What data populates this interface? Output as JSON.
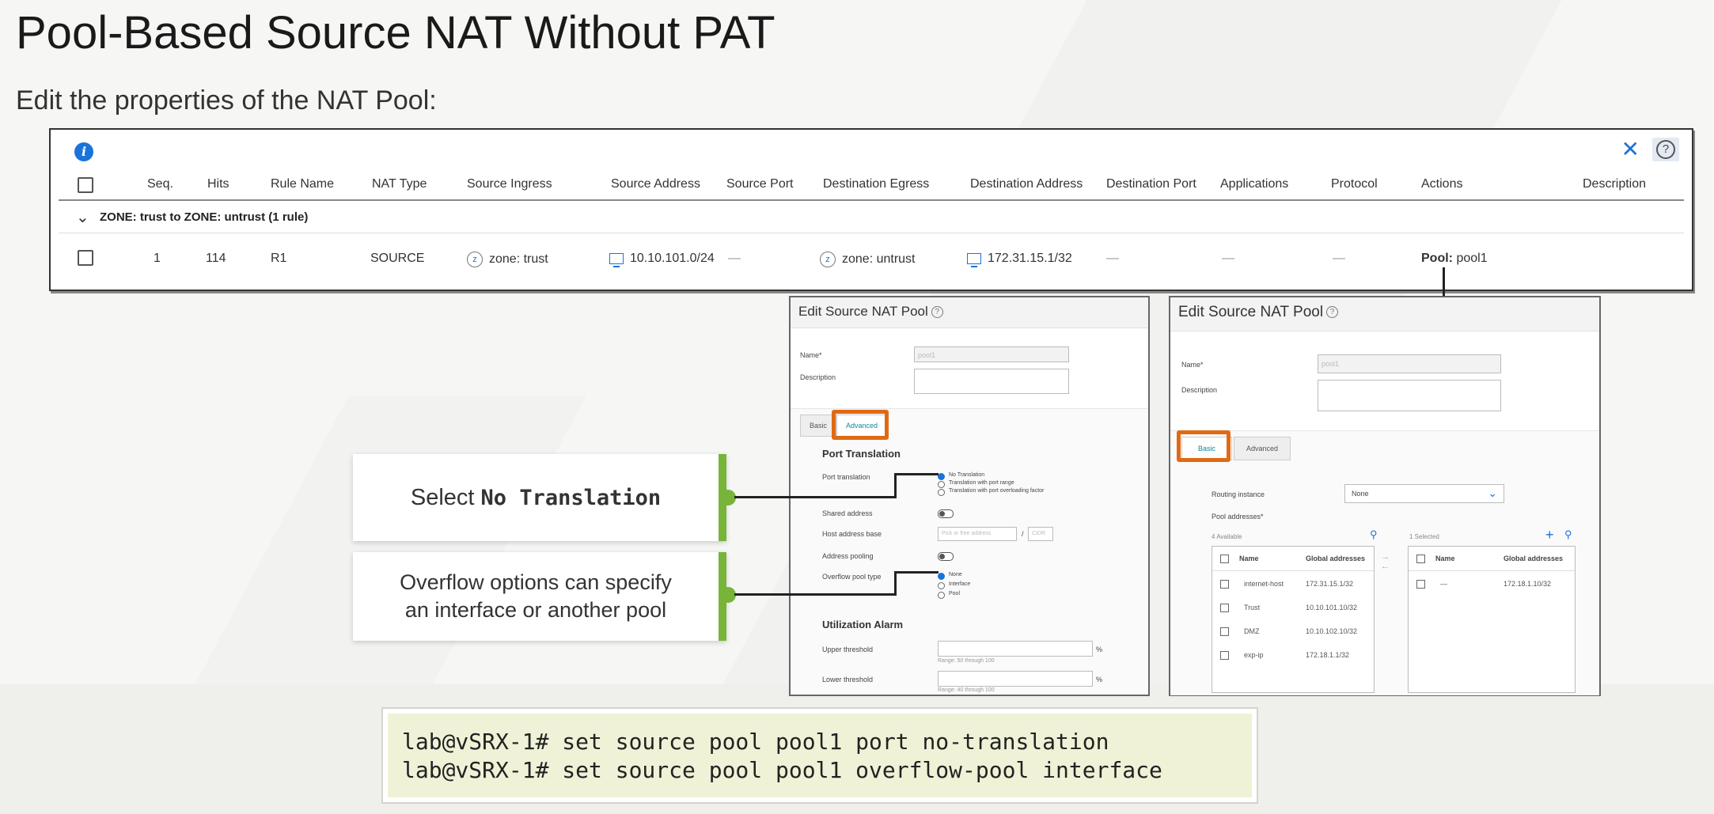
{
  "slide": {
    "title": "Pool-Based Source NAT Without PAT",
    "subtitle": "Edit the properties of the NAT Pool:"
  },
  "rules_table": {
    "columns": [
      "Seq.",
      "Hits",
      "Rule Name",
      "NAT Type",
      "Source Ingress",
      "Source Address",
      "Source Port",
      "Destination Egress",
      "Destination Address",
      "Destination Port",
      "Applications",
      "Protocol",
      "Actions",
      "Description"
    ],
    "group_label": "ZONE: trust to ZONE: untrust (1 rule)",
    "row": {
      "seq": "1",
      "hits": "114",
      "rule_name": "R1",
      "nat_type": "SOURCE",
      "source_ingress": "zone: trust",
      "source_address": "10.10.101.0/24",
      "source_port": "—",
      "destination_egress": "zone: untrust",
      "destination_address": "172.31.15.1/32",
      "destination_port": "—",
      "applications": "—",
      "protocol": "—",
      "action_label": "Pool:",
      "action_value": "pool1"
    },
    "icons": {
      "info": "info-icon",
      "close": "close-icon",
      "help": "help-icon"
    }
  },
  "panel_advanced": {
    "title": "Edit Source NAT Pool",
    "name_label": "Name*",
    "name_value": "pool1",
    "description_label": "Description",
    "tabs": [
      "Basic",
      "Advanced"
    ],
    "port_translation_heading": "Port Translation",
    "port_translation_label": "Port translation",
    "port_translation_options": [
      "No Translation",
      "Translation with port range",
      "Translation with port overloading factor"
    ],
    "shared_address_label": "Shared address",
    "host_address_base_label": "Host address base",
    "host_address_placeholder": "Pick or free address",
    "host_address_sep": "/",
    "host_address_cidr": "CIDR",
    "address_pooling_label": "Address pooling",
    "overflow_label": "Overflow pool type",
    "overflow_options": [
      "None",
      "Interface",
      "Pool"
    ],
    "utilization_heading": "Utilization Alarm",
    "upper_label": "Upper threshold",
    "upper_range": "Range: 50 through 100",
    "lower_label": "Lower threshold",
    "lower_range": "Range: 40 through 100",
    "percent": "%"
  },
  "panel_basic": {
    "title": "Edit Source NAT Pool",
    "name_label": "Name*",
    "name_value": "pool1",
    "description_label": "Description",
    "tabs": [
      "Basic",
      "Advanced"
    ],
    "routing_label": "Routing instance",
    "routing_value": "None",
    "pool_addresses_label": "Pool addresses*",
    "available_count": "4 Available",
    "selected_count": "1 Selected",
    "col_name": "Name",
    "col_global": "Global addresses",
    "available": [
      {
        "name": "internet-host",
        "addr": "172.31.15.1/32"
      },
      {
        "name": "Trust",
        "addr": "10.10.101.10/32"
      },
      {
        "name": "DMZ",
        "addr": "10.10.102.10/32"
      },
      {
        "name": "exp-ip",
        "addr": "172.18.1.1/32"
      }
    ],
    "selected": [
      {
        "name": "—",
        "addr": "172.18.1.10/32"
      }
    ]
  },
  "callouts": {
    "c1_prefix": "Select",
    "c1_code": "No Translation",
    "c2_line1": "Overflow options can specify",
    "c2_line2": "an interface or another pool"
  },
  "cli": {
    "line1": "lab@vSRX-1# set source pool pool1 port no-translation",
    "line2": "lab@vSRX-1# set source pool pool1 overflow-pool interface"
  },
  "colors": {
    "accent_green": "#78b33a",
    "highlight_orange": "#e06a14",
    "link_blue": "#1a73d9",
    "cli_bg": "#eff2d6"
  }
}
